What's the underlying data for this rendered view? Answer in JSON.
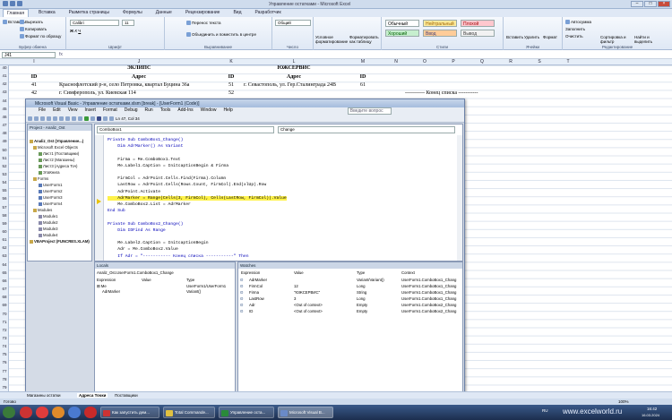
{
  "excel": {
    "title": "Управление остатками - Microsoft Excel",
    "tabs": [
      "Главная",
      "Вставка",
      "Разметка страницы",
      "Формулы",
      "Данные",
      "Рецензирование",
      "Вид",
      "Разработчик"
    ],
    "ribbon": {
      "clipboard": {
        "label": "Буфер обмена",
        "paste": "Вставить",
        "cut": "Вырезать",
        "copy": "Копировать",
        "format_painter": "Формат по образцу"
      },
      "font": {
        "label": "Шрифт",
        "name": "Calibri",
        "size": "11"
      },
      "alignment": {
        "label": "Выравнивание",
        "wrap": "Перенос текста",
        "merge": "Объединить и поместить в центре"
      },
      "number": {
        "label": "Число",
        "format": "Общий"
      },
      "cond_format": "Условное форматирование",
      "as_table": "Форматировать как таблицу",
      "styles": {
        "label": "Стили",
        "normal": "Обычный",
        "neutral": "Нейтральный",
        "bad": "Плохой",
        "good": "Хороший",
        "input": "Ввод",
        "output": "Вывод"
      },
      "cells": {
        "label": "Ячейки",
        "insert": "Вставить",
        "delete": "Удалить",
        "format": "Формат"
      },
      "editing": {
        "label": "Редактирование",
        "autosum": "Автосумма",
        "fill": "Заполнить",
        "clear": "Очистить",
        "sort": "Сортировка и фильтр",
        "find": "Найти и выделить"
      }
    },
    "name_box": "J41",
    "columns": [
      "I",
      "J",
      "K",
      "L",
      "M",
      "N",
      "O",
      "P",
      "Q",
      "R",
      "S",
      "T"
    ],
    "rows": [
      "40",
      "41",
      "42",
      "43",
      "44",
      "45",
      "46",
      "47",
      "48",
      "49",
      "50",
      "51",
      "52",
      "53",
      "54",
      "55",
      "56",
      "57",
      "58",
      "59",
      "60",
      "61",
      "62",
      "63",
      "64",
      "65",
      "66",
      "67",
      "68",
      "69",
      "70",
      "71",
      "72",
      "73",
      "74",
      "75",
      "76",
      "77",
      "78",
      "79",
      "80"
    ],
    "table": {
      "ekl_header": "ЭКЛИПС",
      "yug_header": "ЮЖСЕРВИС",
      "id_label": "ID",
      "addr_label": "Адрес",
      "r1_id": "41",
      "r1_addr": "Краснофлотский р-н, село Петровка, квартал Буцина 36а",
      "r1_k": "51",
      "r1_addr2": "г. Севастополь, ул. Гер.Сталинграда 24В",
      "r1_m": "61",
      "r2_id": "42",
      "r2_addr": "г. Симферополь, ул. Киевская 114",
      "r2_k": "52",
      "end_marker": "----------- Конец списка -----------"
    },
    "sheet_tabs": [
      "Магазины остатки",
      "Адреса Точки",
      "Поставщики"
    ],
    "status": "Готово",
    "zoom": "100%"
  },
  "vbe": {
    "title": "Microsoft Visual Basic - Управление остатками.xlsm [break] - [UserForm1 (Code)]",
    "menu": [
      "File",
      "Edit",
      "View",
      "Insert",
      "Format",
      "Debug",
      "Run",
      "Tools",
      "Add-Ins",
      "Window",
      "Help"
    ],
    "position": "Ln 47, Col 34",
    "ask": "Введите вопрос",
    "project": {
      "header": "Project - Analiz_Ost",
      "items": [
        "Analiz_Ost (Управление...)",
        "Microsoft Excel Objects",
        "Лист1 (Поставщики)",
        "Лист2 (Магазины)",
        "Лист3 (Адреса Точ)",
        "ЭтаКнига",
        "Forms",
        "UserForm1",
        "UserForm2",
        "UserForm3",
        "UserForm4",
        "Modules",
        "Module1",
        "Module2",
        "Module3",
        "Module4",
        "VBAProject (FUNCRES.XLAM)"
      ]
    },
    "object_combo": "ComboBox1",
    "proc_combo": "Change",
    "code": [
      "Private Sub ComboBox1_Change()",
      "    Dim AdrMarker() As Variant",
      "",
      "    Firma = Me.ComboBox1.Text",
      "    Me.Label1.Caption = InitcaptionBegin & Firma",
      "",
      "    FirmCol = AdrPoint.Cells.Find(Firma).Column",
      "    LastRow = AdrPoint.Cells(Rows.Count, FirmCol).End(xlUp).Row",
      "    AdrPoint.Activate",
      "    AdrMarker = Range(Cells(3, FirmCol), Cells(LastRow, FirmCol)).Value",
      "    Me.ComboBox2.List = AdrMarker",
      "End Sub",
      "",
      "Private Sub ComboBox2_Change()",
      "    Dim IDFind As Range",
      "",
      "    Me.Label2.Caption = InitcaptionBegin",
      "    Adr = Me.ComboBox2.Value",
      "    If Adr = \"----------- Конец списка -----------\" Then"
    ],
    "locals": {
      "header": "Locals",
      "context": "Analiz_Ost.UserForm1.ComboBox1_Change",
      "cols": [
        "Expression",
        "Value",
        "Type"
      ],
      "rows": [
        [
          "Me",
          "",
          "UserForm1/UserForm1"
        ],
        [
          "AdrMarker",
          "",
          "Variant()"
        ]
      ]
    },
    "watches": {
      "header": "Watches",
      "cols": [
        "Expression",
        "Value",
        "Type",
        "Context"
      ],
      "rows": [
        [
          "AdrMarker",
          "",
          "Variant/Variant()",
          "UserForm1.ComboBox1_Chang"
        ],
        [
          "FirmCol",
          "12",
          "Long",
          "UserForm1.ComboBox1_Chang"
        ],
        [
          "Firma",
          "\"ЮЖСЕРВИС\"",
          "String",
          "UserForm1.ComboBox1_Chang"
        ],
        [
          "LastRow",
          "3",
          "Long",
          "UserForm1.ComboBox1_Chang"
        ],
        [
          "Adr",
          "<Out of context>",
          "Empty",
          "UserForm1.ComboBox2_Chang"
        ],
        [
          "ID",
          "<Out of context>",
          "Empty",
          "UserForm1.ComboBox2_Chang"
        ]
      ]
    }
  },
  "taskbar": {
    "items": [
      "Как запустить дем...",
      "Total Commande...",
      "Управление оста...",
      "Microsoft Visual B..."
    ],
    "site": "www.excelworld.ru",
    "clock": "16:42",
    "date": "16.03.2024",
    "lang": "RU"
  }
}
